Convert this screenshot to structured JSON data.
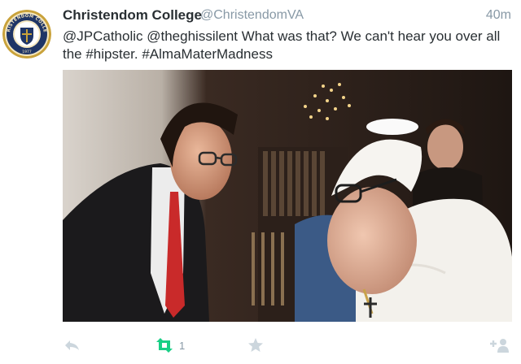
{
  "tweet": {
    "display_name": "Christendom College",
    "screen_name": "@ChristendomVA",
    "timestamp": "40m",
    "text": "@JPCatholic @theghissilent What was that? We can't hear you over all the #hipster. #AlmaMaterMadness",
    "retweet_count": "1",
    "avatar": {
      "logo_text": "CHRISTENDOM COLLEGE",
      "logo_year": "1977",
      "colors": {
        "ring": "#c9a23b",
        "inner": "#1f3566"
      }
    },
    "photo": {
      "alt_icon": "photo-image"
    }
  },
  "actions": {
    "reply_icon": "reply-icon",
    "retweet_icon": "retweet-icon",
    "favorite_icon": "star-icon",
    "follow_icon": "follow-icon"
  },
  "colors": {
    "name": "#292f33",
    "meta": "#8899a6",
    "retweet_active": "#19cf86",
    "icon_gray": "#ccd6dd"
  }
}
